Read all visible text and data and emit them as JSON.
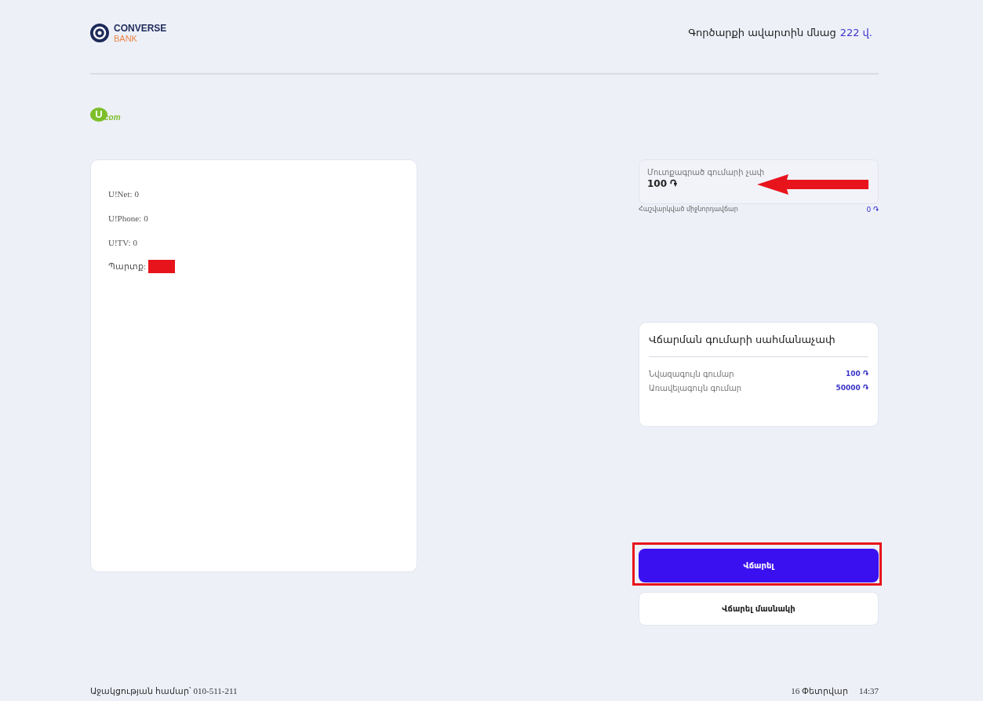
{
  "header": {
    "bank_logo": {
      "name": "CONVERSE",
      "sub": "BANK"
    },
    "timer": {
      "label": "Գործարքի ավարտին մնաց",
      "value": "222 վ."
    }
  },
  "provider_logo": {
    "mark": "U",
    "text": "com"
  },
  "balances": [
    {
      "label": "U!Net:",
      "value": "0"
    },
    {
      "label": "U!Phone:",
      "value": "0"
    },
    {
      "label": "U!TV:",
      "value": "0"
    },
    {
      "label": "Պարտք:",
      "redacted": true
    }
  ],
  "amount_field": {
    "label": "Մուտքագրած գումարի չափ",
    "value": "100 ֏"
  },
  "commission": {
    "label": "Հաշվարկված միջնորդավճար",
    "value": "0 ֏"
  },
  "limits": {
    "title": "Վճարման գումարի սահմանաչափ",
    "rows": [
      {
        "label": "Նվազագույն գումար",
        "value": "100 ֏"
      },
      {
        "label": "Առավելագույն գումար",
        "value": "50000 ֏"
      }
    ]
  },
  "buttons": [
    {
      "label": "Վճարել",
      "kind": "primary",
      "highlighted": true
    },
    {
      "label": "Վճարել մասնակի",
      "kind": "secondary",
      "highlighted": false
    }
  ],
  "footer": {
    "support": "Աջակցության համար՝ 010-511-211",
    "date": "16 Փետրվար",
    "time": "14:37"
  }
}
